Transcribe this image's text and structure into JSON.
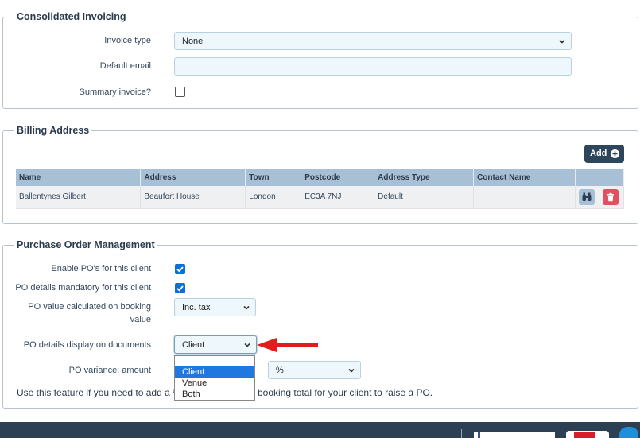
{
  "consolidated": {
    "legend": "Consolidated Invoicing",
    "invoice_type_label": "Invoice type",
    "invoice_type_value": "None",
    "default_email_label": "Default email",
    "default_email_value": "",
    "summary_label": "Summary invoice?",
    "summary_checked": false
  },
  "billing": {
    "legend": "Billing Address",
    "add_label": "Add",
    "columns": [
      "Name",
      "Address",
      "Town",
      "Postcode",
      "Address Type",
      "Contact Name",
      "",
      ""
    ],
    "rows": [
      {
        "name": "Ballentynes Gilbert",
        "address": "Beaufort House",
        "town": "London",
        "postcode": "EC3A 7NJ",
        "type": "Default",
        "contact": ""
      }
    ]
  },
  "po": {
    "legend": "Purchase Order Management",
    "enable_label": "Enable PO's for this client",
    "enable_checked": true,
    "mandatory_label": "PO details mandatory for this client",
    "mandatory_checked": true,
    "value_calc_label_1": "PO value calculated on booking",
    "value_calc_label_2": "value",
    "value_calc_value": "Inc. tax",
    "display_label": "PO details display on documents",
    "display_value": "Client",
    "display_options": [
      "Client",
      "Venue",
      "Both"
    ],
    "variance_label": "PO variance: amount",
    "variance_unit": "%",
    "help_prefix": "Use this feature if you need to add a %",
    "help_suffix": "booking total for your client to raise a PO."
  },
  "colors": {
    "accent": "#0a6fd6",
    "header_bg": "#a8c0d6",
    "add_bg": "#2d465c",
    "delete_bg": "#e0505e",
    "arrow": "#e21b1b"
  }
}
